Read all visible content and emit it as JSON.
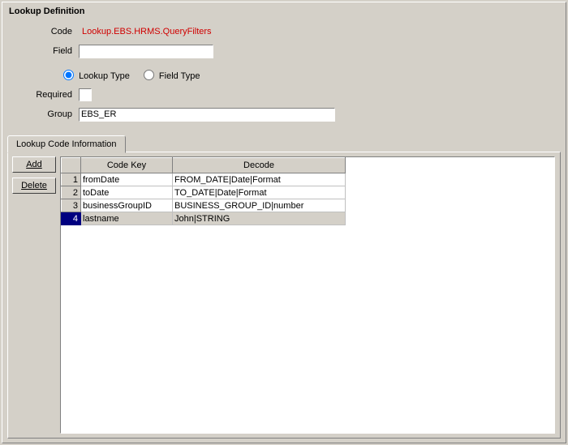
{
  "panel": {
    "title": "Lookup Definition"
  },
  "form": {
    "code_label": "Code",
    "code_value": "Lookup.EBS.HRMS.QueryFilters",
    "field_label": "Field",
    "field_value": "",
    "lookup_type_label": "Lookup Type",
    "field_type_label": "Field Type",
    "required_label": "Required",
    "group_label": "Group",
    "group_value": "EBS_ER"
  },
  "tab": {
    "title": "Lookup Code Information"
  },
  "buttons": {
    "add": "Add",
    "delete": "Delete"
  },
  "tableHeaders": {
    "codeKey": "Code Key",
    "decode": "Decode"
  },
  "rows": [
    {
      "n": "1",
      "key": "fromDate",
      "decode": "FROM_DATE|Date|Format"
    },
    {
      "n": "2",
      "key": "toDate",
      "decode": "TO_DATE|Date|Format"
    },
    {
      "n": "3",
      "key": "businessGroupID",
      "decode": "BUSINESS_GROUP_ID|number"
    },
    {
      "n": "4",
      "key": "lastname",
      "decode": "John|STRING"
    }
  ],
  "selectedRow": 3
}
